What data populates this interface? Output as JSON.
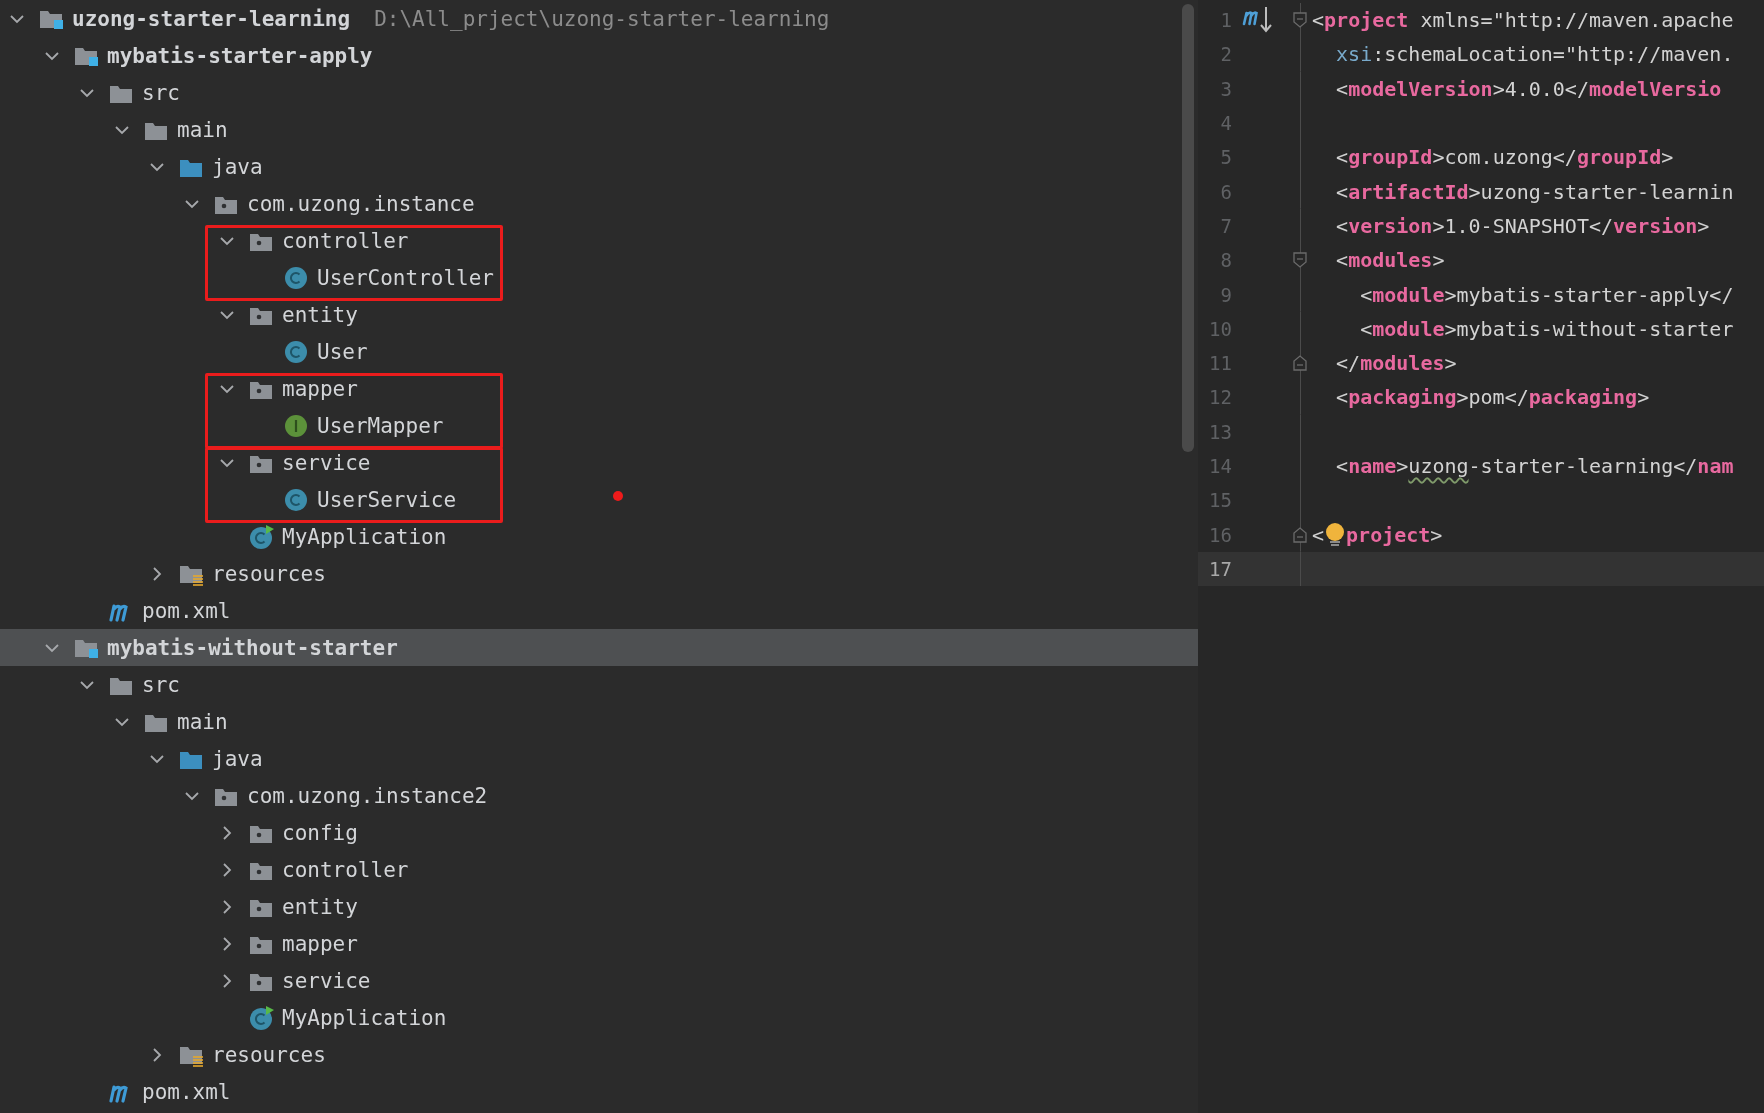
{
  "tree": {
    "label": "uzong-starter-learning",
    "kind": "module",
    "path": "D:\\All_prject\\uzong-starter-learning",
    "expanded": true,
    "selected": false,
    "children": [
      {
        "label": "mybatis-starter-apply",
        "kind": "module",
        "expanded": true,
        "selected": false,
        "children": [
          {
            "label": "src",
            "kind": "folder",
            "expanded": true,
            "selected": false,
            "children": [
              {
                "label": "main",
                "kind": "folder",
                "expanded": true,
                "selected": false,
                "children": [
                  {
                    "label": "java",
                    "kind": "source-root",
                    "expanded": true,
                    "selected": false,
                    "children": [
                      {
                        "label": "com.uzong.instance",
                        "kind": "package",
                        "expanded": true,
                        "selected": false,
                        "children": [
                          {
                            "label": "controller",
                            "kind": "package",
                            "expanded": true,
                            "selected": false,
                            "outlined": true,
                            "children": [
                              {
                                "label": "UserController",
                                "kind": "class",
                                "selected": false
                              }
                            ]
                          },
                          {
                            "label": "entity",
                            "kind": "package",
                            "expanded": true,
                            "selected": false,
                            "children": [
                              {
                                "label": "User",
                                "kind": "class",
                                "selected": false
                              }
                            ]
                          },
                          {
                            "label": "mapper",
                            "kind": "package",
                            "expanded": true,
                            "selected": false,
                            "outlined": true,
                            "children": [
                              {
                                "label": "UserMapper",
                                "kind": "interface",
                                "selected": false
                              }
                            ]
                          },
                          {
                            "label": "service",
                            "kind": "package",
                            "expanded": true,
                            "selected": false,
                            "outlined": true,
                            "children": [
                              {
                                "label": "UserService",
                                "kind": "class",
                                "selected": false
                              }
                            ]
                          },
                          {
                            "label": "MyApplication",
                            "kind": "app",
                            "selected": false
                          }
                        ]
                      }
                    ]
                  },
                  {
                    "label": "resources",
                    "kind": "resources",
                    "expanded": false,
                    "selected": false
                  }
                ]
              }
            ]
          },
          {
            "label": "pom.xml",
            "kind": "maven",
            "selected": false
          }
        ]
      },
      {
        "label": "mybatis-without-starter",
        "kind": "module",
        "expanded": true,
        "selected": true,
        "children": [
          {
            "label": "src",
            "kind": "folder",
            "expanded": true,
            "selected": false,
            "children": [
              {
                "label": "main",
                "kind": "folder",
                "expanded": true,
                "selected": false,
                "children": [
                  {
                    "label": "java",
                    "kind": "source-root",
                    "expanded": true,
                    "selected": false,
                    "children": [
                      {
                        "label": "com.uzong.instance2",
                        "kind": "package",
                        "expanded": true,
                        "selected": false,
                        "children": [
                          {
                            "label": "config",
                            "kind": "package",
                            "expanded": false,
                            "selected": false
                          },
                          {
                            "label": "controller",
                            "kind": "package",
                            "expanded": false,
                            "selected": false
                          },
                          {
                            "label": "entity",
                            "kind": "package",
                            "expanded": false,
                            "selected": false
                          },
                          {
                            "label": "mapper",
                            "kind": "package",
                            "expanded": false,
                            "selected": false
                          },
                          {
                            "label": "service",
                            "kind": "package",
                            "expanded": false,
                            "selected": false
                          },
                          {
                            "label": "MyApplication",
                            "kind": "app",
                            "selected": false
                          }
                        ]
                      }
                    ]
                  },
                  {
                    "label": "resources",
                    "kind": "resources",
                    "expanded": false,
                    "selected": false
                  }
                ]
              }
            ]
          },
          {
            "label": "pom.xml",
            "kind": "maven",
            "selected": false
          }
        ]
      }
    ]
  },
  "editor": {
    "lines": [
      {
        "number": "1",
        "current": false,
        "fold_open": true,
        "maven_marker": true,
        "tokens": [
          {
            "text": "<",
            "kind": "punct"
          },
          {
            "text": "project",
            "kind": "tag"
          },
          {
            "text": " xmlns=",
            "kind": "attr"
          },
          {
            "text": "\"http://maven.apache",
            "kind": "string"
          }
        ]
      },
      {
        "number": "2",
        "current": false,
        "tokens": [
          {
            "text": "  xsi",
            "kind": "ns"
          },
          {
            "text": ":schemaLocation=",
            "kind": "attr"
          },
          {
            "text": "\"http://maven.",
            "kind": "string"
          }
        ]
      },
      {
        "number": "3",
        "current": false,
        "tokens": [
          {
            "text": "  <",
            "kind": "punct"
          },
          {
            "text": "modelVersion",
            "kind": "tag"
          },
          {
            "text": ">4.0.0</",
            "kind": "text"
          },
          {
            "text": "modelVersio",
            "kind": "tag"
          }
        ]
      },
      {
        "number": "4",
        "current": false
      },
      {
        "number": "5",
        "current": false,
        "tokens": [
          {
            "text": "  <",
            "kind": "punct"
          },
          {
            "text": "groupId",
            "kind": "tag"
          },
          {
            "text": ">com.uzong</",
            "kind": "text"
          },
          {
            "text": "groupId",
            "kind": "tag"
          },
          {
            "text": ">",
            "kind": "punct"
          }
        ]
      },
      {
        "number": "6",
        "current": false,
        "tokens": [
          {
            "text": "  <",
            "kind": "punct"
          },
          {
            "text": "artifactId",
            "kind": "tag"
          },
          {
            "text": ">uzong-starter-learnin",
            "kind": "text"
          }
        ]
      },
      {
        "number": "7",
        "current": false,
        "tokens": [
          {
            "text": "  <",
            "kind": "punct"
          },
          {
            "text": "version",
            "kind": "tag"
          },
          {
            "text": ">1.0-SNAPSHOT</",
            "kind": "text"
          },
          {
            "text": "version",
            "kind": "tag"
          },
          {
            "text": ">",
            "kind": "punct"
          }
        ]
      },
      {
        "number": "8",
        "current": false,
        "fold_open": true,
        "tokens": [
          {
            "text": "  <",
            "kind": "punct"
          },
          {
            "text": "modules",
            "kind": "tag"
          },
          {
            "text": ">",
            "kind": "punct"
          }
        ]
      },
      {
        "number": "9",
        "current": false,
        "tokens": [
          {
            "text": "    <",
            "kind": "punct"
          },
          {
            "text": "module",
            "kind": "tag"
          },
          {
            "text": ">mybatis-starter-apply</",
            "kind": "text"
          }
        ]
      },
      {
        "number": "10",
        "current": false,
        "tokens": [
          {
            "text": "    <",
            "kind": "punct"
          },
          {
            "text": "module",
            "kind": "tag"
          },
          {
            "text": ">mybatis-without-starter",
            "kind": "text"
          }
        ]
      },
      {
        "number": "11",
        "current": false,
        "fold_close": true,
        "tokens": [
          {
            "text": "  </",
            "kind": "punct"
          },
          {
            "text": "modules",
            "kind": "tag"
          },
          {
            "text": ">",
            "kind": "punct"
          }
        ]
      },
      {
        "number": "12",
        "current": false,
        "tokens": [
          {
            "text": "  <",
            "kind": "punct"
          },
          {
            "text": "packaging",
            "kind": "tag"
          },
          {
            "text": ">pom</",
            "kind": "text"
          },
          {
            "text": "packaging",
            "kind": "tag"
          },
          {
            "text": ">",
            "kind": "punct"
          }
        ]
      },
      {
        "number": "13",
        "current": false
      },
      {
        "number": "14",
        "current": false,
        "tokens": [
          {
            "text": "  <",
            "kind": "punct"
          },
          {
            "text": "name",
            "kind": "tag"
          },
          {
            "text": ">",
            "kind": "punct"
          },
          {
            "text": "uzong",
            "kind": "typo"
          },
          {
            "text": "-starter-learning</",
            "kind": "text"
          },
          {
            "text": "nam",
            "kind": "tag"
          }
        ]
      },
      {
        "number": "15",
        "current": false
      },
      {
        "number": "16",
        "current": false,
        "fold_close": true,
        "tokens": [
          {
            "text": "<",
            "kind": "punct"
          },
          {
            "kind": "bulb"
          },
          {
            "text": "project",
            "kind": "tag"
          },
          {
            "text": ">",
            "kind": "punct"
          }
        ]
      },
      {
        "number": "17",
        "current": true
      }
    ]
  }
}
